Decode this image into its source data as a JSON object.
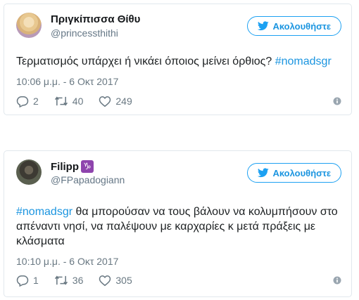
{
  "follow_label": "Ακολουθήστε",
  "tweets": [
    {
      "name": "Πριγκίπισσα Θίθυ",
      "handle": "@princessthithi",
      "text": "Τερματισμός υπάρχει ή νικάει όποιος μείνει όρθιος? ",
      "hashtag": "#nomadsgr",
      "timestamp": "10:06 μ.μ. - 6 Οκτ 2017",
      "replies": "2",
      "retweets": "40",
      "likes": "249"
    },
    {
      "name": "Filipp",
      "name_badge": "♑",
      "handle": "@FPapadogiann",
      "hashtag": "#nomadsgr",
      "text": " θα μπορούσαν να τους βάλουν να κολυμπήσουν στο απέναντι νησί, να παλέψουν με καρχαρίες κ μετά πράξεις με κλάσματα",
      "timestamp": "10:10 μ.μ. - 6 Οκτ 2017",
      "replies": "1",
      "retweets": "36",
      "likes": "305"
    }
  ],
  "colors": {
    "accent": "#1da1f2",
    "link": "#1b95e0",
    "muted": "#697882",
    "border": "#e1e8ed"
  }
}
